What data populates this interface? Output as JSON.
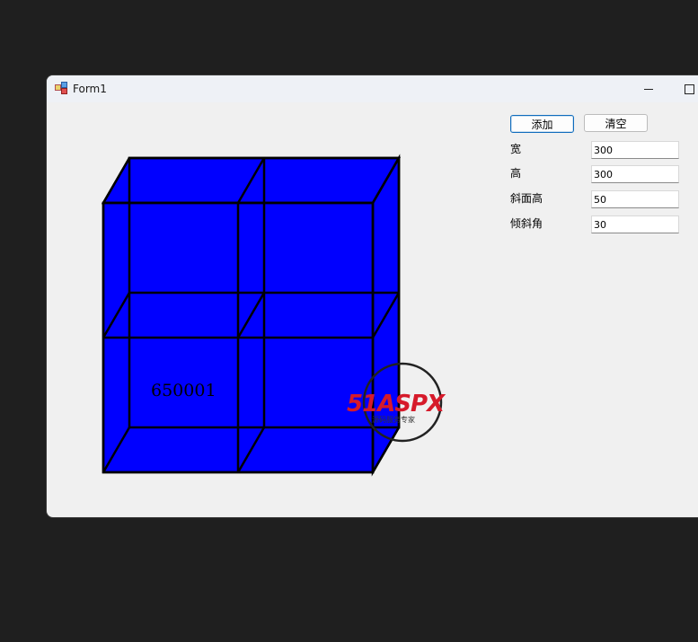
{
  "window": {
    "title": "Form1"
  },
  "toolbar": {
    "add_label": "添加",
    "clear_label": "清空"
  },
  "fields": [
    {
      "label": "宽",
      "value": "300"
    },
    {
      "label": "高",
      "value": "300"
    },
    {
      "label": "斜面高",
      "value": "50"
    },
    {
      "label": "倾斜角",
      "value": "30"
    }
  ],
  "drawing": {
    "cube_label": "650001",
    "fill_color": "#0000ff",
    "stroke_color": "#000000"
  },
  "watermark": {
    "brand": "51ASPX",
    "tagline": "源码服务专家"
  },
  "icons": {
    "app": "form-app-icon",
    "minimize": "minimize-icon",
    "maximize": "maximize-icon"
  }
}
